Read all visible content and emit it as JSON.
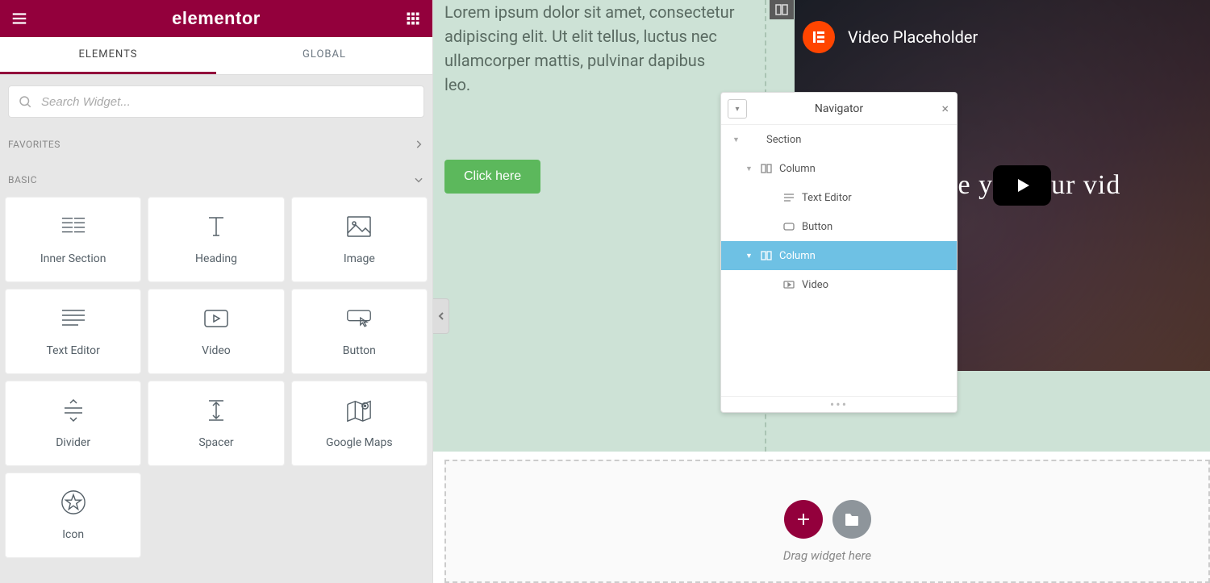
{
  "panel": {
    "brand": "elementor",
    "tabs": {
      "elements": "ELEMENTS",
      "global": "GLOBAL"
    },
    "search_placeholder": "Search Widget...",
    "sections": {
      "favorites": "FAVORITES",
      "basic": "BASIC"
    },
    "widgets": [
      "Inner Section",
      "Heading",
      "Image",
      "Text Editor",
      "Video",
      "Button",
      "Divider",
      "Spacer",
      "Google Maps",
      "Icon"
    ]
  },
  "canvas": {
    "lorem": "Lorem ipsum dolor sit amet, consectetur adipiscing elit. Ut elit tellus, luctus nec ullamcorper mattis, pulvinar dapibus leo.",
    "button_label": "Click here",
    "video": {
      "title": "Video Placeholder",
      "overlay_left": "Choose y",
      "overlay_right": "ur vid"
    },
    "dropzone_hint": "Drag widget here"
  },
  "navigator": {
    "title": "Navigator",
    "items": [
      {
        "label": "Section",
        "icon": "",
        "indent": 0,
        "toggle": true,
        "selected": false
      },
      {
        "label": "Column",
        "icon": "column",
        "indent": 1,
        "toggle": true,
        "selected": false
      },
      {
        "label": "Text Editor",
        "icon": "text",
        "indent": 2,
        "toggle": false,
        "selected": false
      },
      {
        "label": "Button",
        "icon": "button",
        "indent": 2,
        "toggle": false,
        "selected": false
      },
      {
        "label": "Column",
        "icon": "column",
        "indent": 1,
        "toggle": true,
        "selected": true
      },
      {
        "label": "Video",
        "icon": "video",
        "indent": 2,
        "toggle": false,
        "selected": false
      }
    ]
  },
  "colors": {
    "brand": "#93003c",
    "accent_blue": "#6ec1e4",
    "green": "#5cb85c",
    "canvas_bg": "#cde2d6"
  }
}
